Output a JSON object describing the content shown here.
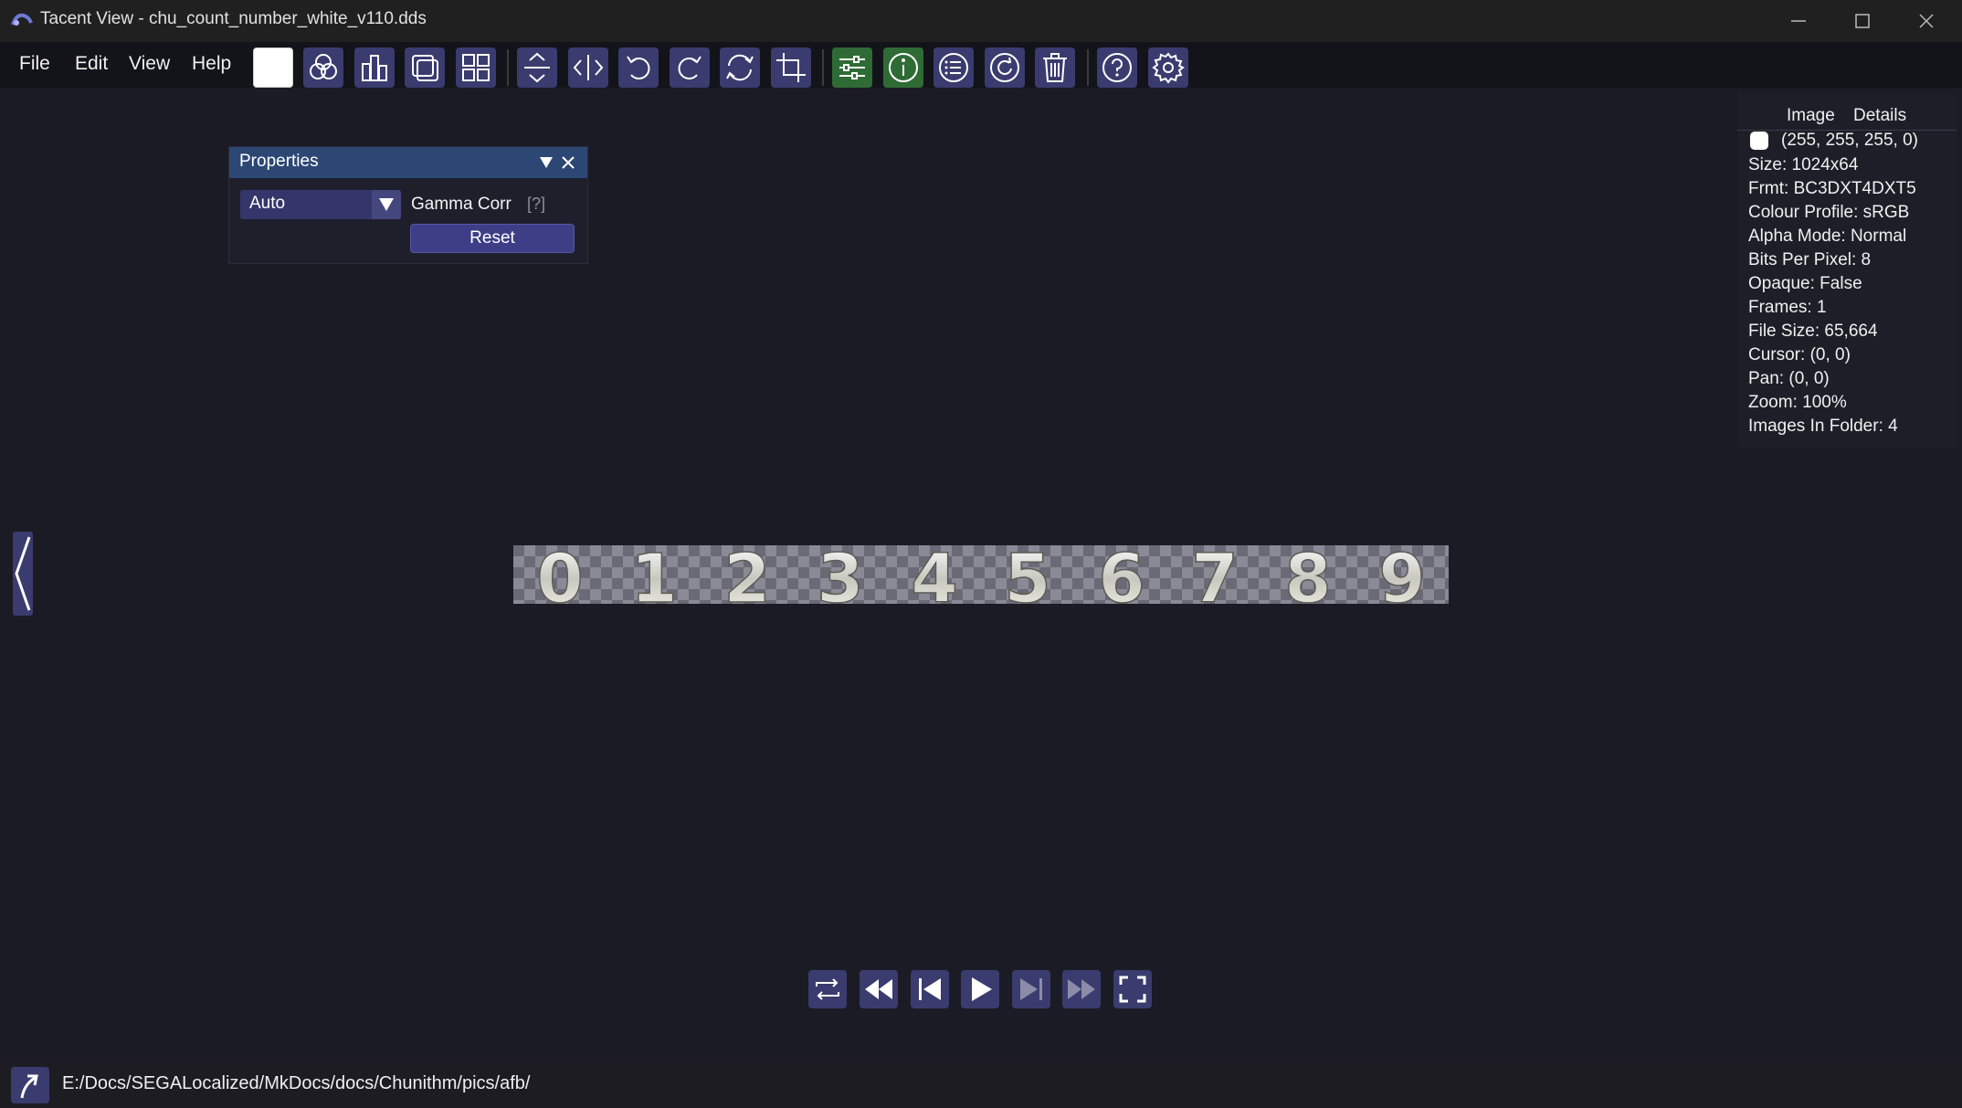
{
  "window": {
    "title": "Tacent View - chu_count_number_white_v110.dds"
  },
  "menu": [
    "File",
    "Edit",
    "View",
    "Help"
  ],
  "toolbar": {
    "buttons": [
      "background-swatch-icon",
      "channel-filter-icon",
      "levels-icon",
      "tile-icon",
      "thumbnail-view-icon",
      "flip-vertical-icon",
      "flip-horizontal-icon",
      "rotate-left-icon",
      "rotate-right-icon",
      "rotate-any-icon",
      "crop-icon",
      "properties-icon",
      "info-icon",
      "content-view-icon",
      "refresh-icon",
      "delete-icon",
      "help-icon",
      "settings-icon"
    ],
    "active_color": "#2f6b35",
    "button_color": "#3a3b6e"
  },
  "properties": {
    "title": "Properties",
    "gamma_mode": "Auto",
    "gamma_label": "Gamma Corr",
    "help_marker": "[?]",
    "reset_label": "Reset"
  },
  "details": {
    "tabs": [
      "Image",
      "Details"
    ],
    "pixel_colour": "(255, 255, 255, 0)",
    "rows": [
      "Size: 1024x64",
      "Frmt: BC3DXT4DXT5",
      "Colour Profile: sRGB",
      "Alpha Mode: Normal",
      "Bits Per Pixel: 8",
      "Opaque: False",
      "Frames: 1",
      "File Size: 65,664",
      "Cursor: (0, 0)",
      "Pan: (0, 0)",
      "Zoom: 100%",
      "Images In Folder: 4"
    ]
  },
  "image": {
    "digits": [
      "0",
      "1",
      "2",
      "3",
      "4",
      "5",
      "6",
      "7",
      "8",
      "9"
    ]
  },
  "playback": [
    "loop-icon",
    "skip-to-start-icon",
    "previous-frame-icon",
    "play-icon",
    "next-frame-icon",
    "skip-to-end-icon",
    "fullscreen-icon"
  ],
  "footer": {
    "path": "E:/Docs/SEGALocalized/MkDocs/docs/Chunithm/pics/afb/"
  }
}
